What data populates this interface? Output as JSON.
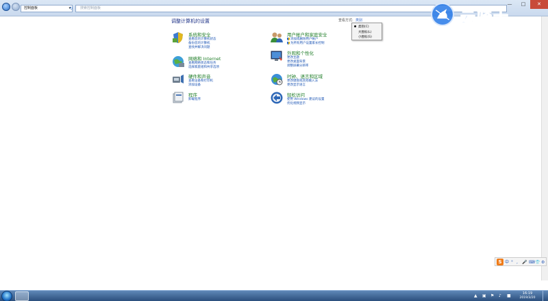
{
  "address": {
    "location": "控制面板",
    "search_placeholder": "搜索控制面板"
  },
  "window_controls": {
    "minimize": "—",
    "maximize": "□",
    "close": "✕"
  },
  "heading": "调整计算机的设置",
  "view": {
    "label": "查看方式:",
    "value": "类别",
    "menu": [
      "类别(C)",
      "大图标(L)",
      "小图标(S)"
    ]
  },
  "categories_left": [
    {
      "title": "系统和安全",
      "icon": "system-security-icon",
      "links": [
        "查看您的计算机状态",
        "备份您的计算机",
        "查找并解决问题"
      ]
    },
    {
      "title": "网络和 Internet",
      "icon": "network-internet-icon",
      "links": [
        "查看网络状态和任务",
        "选择家庭组和共享选项"
      ]
    },
    {
      "title": "硬件和声音",
      "icon": "hardware-sound-icon",
      "links": [
        "查看设备和打印机",
        "添加设备"
      ]
    },
    {
      "title": "程序",
      "icon": "programs-icon",
      "links": [
        "卸载程序"
      ]
    }
  ],
  "categories_right": [
    {
      "title": "用户帐户和家庭安全",
      "icon": "user-accounts-icon",
      "links": [
        "添加或删除用户帐户",
        "为所有用户设置家长控制"
      ]
    },
    {
      "title": "外观和个性化",
      "icon": "appearance-icon",
      "links": [
        "更改主题",
        "更改桌面背景",
        "调整屏幕分辨率"
      ]
    },
    {
      "title": "时钟、语言和区域",
      "icon": "clock-language-icon",
      "links": [
        "更改键盘或其他输入法",
        "更改显示语言"
      ]
    },
    {
      "title": "轻松访问",
      "icon": "ease-of-access-icon",
      "links": [
        "使用 Windows 建议的设置",
        "优化视频显示"
      ]
    }
  ],
  "watermark": {
    "text": "云骑士"
  },
  "ime": {
    "logo": "S",
    "items": [
      "中",
      "°",
      ",",
      "🎤",
      "⌨",
      "👕",
      "⚙"
    ]
  },
  "taskbar": {
    "time": "16:19",
    "date": "2019/3/20"
  },
  "colors": {
    "title_green": "#1f7d28",
    "link_blue": "#1b54b4",
    "heading_blue": "#1e3287"
  }
}
